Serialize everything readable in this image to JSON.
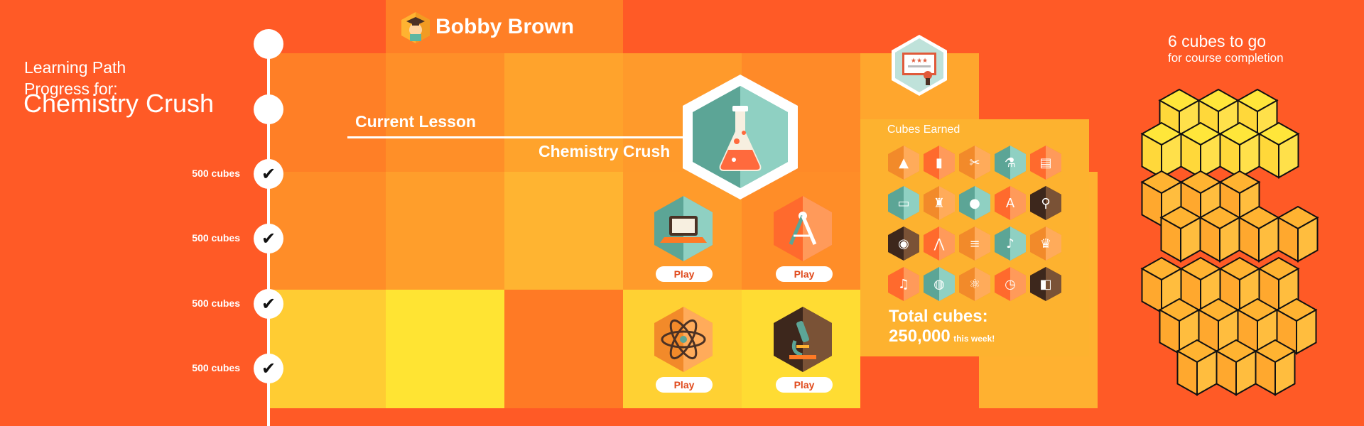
{
  "colors": {
    "background": "#ff5a26",
    "grid_row1": [
      "#ff7f26",
      "#ff8f28",
      "#ffa32c",
      "#ff9a2b",
      "#ff8a28",
      "#ffa62d",
      "#ff5a26"
    ],
    "grid_row2": [
      "#ff8d28",
      "#ff9e2b",
      "#ffb431",
      "#ff9b2b",
      "#ff8d28",
      "#ff5a26",
      "#ffb130"
    ],
    "grid_row3": [
      "#ffcc33",
      "#ffe433",
      "#ff7a25",
      "#ffd133",
      "#ffdc33",
      "#ff5a26",
      "#ffb130"
    ],
    "teal": "#5cb6a2",
    "brown": "#4b3124",
    "cube_yellow": "#ffe63a",
    "cube_orange": "#ffb331"
  },
  "student": {
    "name": "Bobby Brown",
    "avatar_icon": "graduate-avatar-icon"
  },
  "learning_path": {
    "title_line1": "Learning Path",
    "title_line2": "Progress for:",
    "course_name": "Chemistry Crush"
  },
  "timeline": {
    "nodes": [
      {
        "label": "",
        "completed": false
      },
      {
        "label": "",
        "completed": false
      },
      {
        "label": "500 cubes",
        "completed": true,
        "check": "✔"
      },
      {
        "label": "500 cubes",
        "completed": true,
        "check": "✔"
      },
      {
        "label": "500 cubes",
        "completed": true,
        "check": "✔"
      },
      {
        "label": "500 cubes",
        "completed": true,
        "check": "✔"
      }
    ]
  },
  "current_lesson": {
    "label": "Current Lesson",
    "name": "Chemistry Crush",
    "icon": "flask-icon"
  },
  "games": [
    {
      "icon": "laptop-icon",
      "play_label": "Play"
    },
    {
      "icon": "compass-icon",
      "play_label": "Play"
    },
    {
      "icon": "atom-icon",
      "play_label": "Play"
    },
    {
      "icon": "microscope-icon",
      "play_label": "Play"
    }
  ],
  "certificate": {
    "icon": "certificate-icon"
  },
  "cubes_earned": {
    "title": "Cubes Earned",
    "badges": [
      "graduation-cap-icon",
      "book-icon",
      "scissors-icon",
      "flask-icon",
      "open-book-icon",
      "laptop-icon",
      "robot-icon",
      "basketball-icon",
      "abc-blocks-icon",
      "microscope-icon",
      "headphones-icon",
      "compass-icon",
      "books-stack-icon",
      "bell-icon",
      "trophy-icon",
      "violin-icon",
      "globe-icon",
      "atom-icon",
      "clock-icon",
      "paint-icon"
    ],
    "total_label": "Total cubes:",
    "total_value": "250,000",
    "total_period": "this week!"
  },
  "cubes_to_go": {
    "count_text": "6 cubes to go",
    "sub_text": "for course completion"
  }
}
